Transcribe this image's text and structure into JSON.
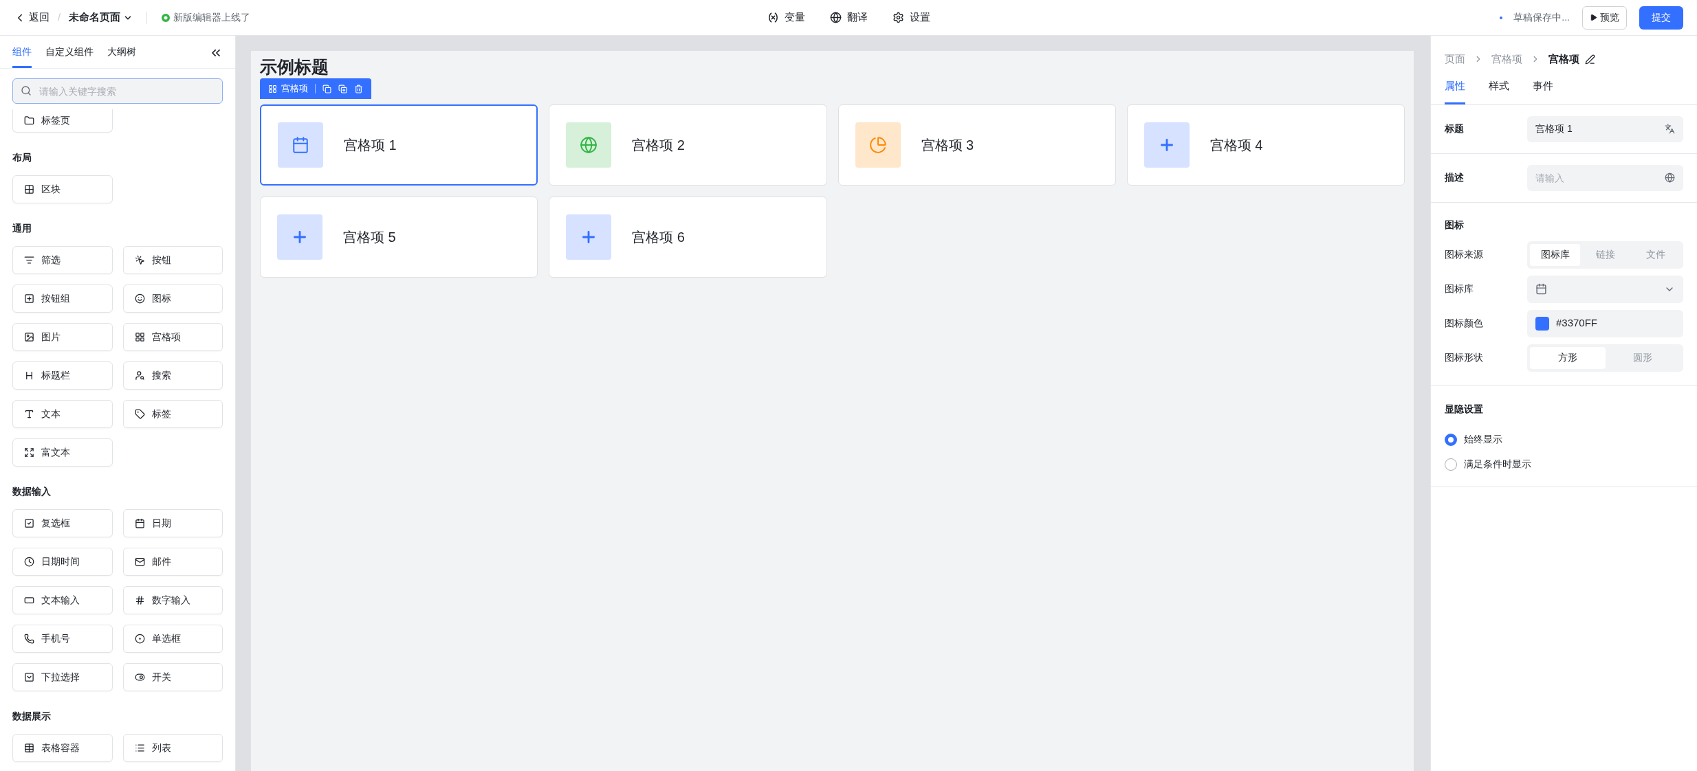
{
  "topbar": {
    "back": "返回",
    "separator": "/",
    "page_title": "未命名页面",
    "notice": "新版编辑器上线了",
    "tools": [
      "变量",
      "翻译",
      "设置"
    ],
    "save_status": "草稿保存中...",
    "preview": "预览",
    "submit": "提交"
  },
  "sidebar": {
    "tabs": [
      {
        "label": "组件",
        "selected": true
      },
      {
        "label": "自定义组件",
        "selected": false
      },
      {
        "label": "大纲树",
        "selected": false
      }
    ],
    "search": {
      "placeholder": "请输入关键字搜索"
    },
    "partial_item": "标签页",
    "sections": [
      {
        "title": "布局",
        "items": [
          "区块"
        ]
      },
      {
        "title": "通用",
        "items": [
          "筛选",
          "按钮",
          "按钮组",
          "图标",
          "图片",
          "宫格项",
          "标题栏",
          "搜索",
          "文本",
          "标签",
          "富文本"
        ]
      },
      {
        "title": "数据输入",
        "items": [
          "复选框",
          "日期",
          "日期时间",
          "邮件",
          "文本输入",
          "数字输入",
          "手机号",
          "单选框",
          "下拉选择",
          "开关"
        ]
      },
      {
        "title": "数据展示",
        "items": [
          "表格容器",
          "列表"
        ]
      }
    ]
  },
  "canvas": {
    "title": "示例标题",
    "toolbar": {
      "label": "宫格项"
    },
    "grid_items": [
      {
        "title": "宫格项 1",
        "kind": "calendar",
        "color": "#3370ff",
        "selected": true
      },
      {
        "title": "宫格项 2",
        "kind": "globe",
        "color": "#34b545",
        "selected": false
      },
      {
        "title": "宫格项 3",
        "kind": "pie",
        "color": "#ff8800",
        "selected": false
      },
      {
        "title": "宫格项 4",
        "kind": "plus",
        "color": "#3370ff",
        "selected": false
      },
      {
        "title": "宫格项 5",
        "kind": "plus",
        "color": "#3370ff",
        "selected": false
      },
      {
        "title": "宫格项 6",
        "kind": "plus",
        "color": "#3370ff",
        "selected": false
      }
    ]
  },
  "inspector": {
    "breadcrumb": [
      "页面",
      "宫格项",
      "宫格项"
    ],
    "tabs": [
      {
        "label": "属性",
        "selected": true
      },
      {
        "label": "样式",
        "selected": false
      },
      {
        "label": "事件",
        "selected": false
      }
    ],
    "title_field": {
      "label": "标题",
      "value": "宫格项 1"
    },
    "desc_field": {
      "label": "描述",
      "placeholder": "请输入"
    },
    "icon_section": {
      "title": "图标",
      "source": {
        "label": "图标来源",
        "options": [
          {
            "label": "图标库",
            "selected": true
          },
          {
            "label": "链接",
            "selected": false
          },
          {
            "label": "文件",
            "selected": false
          }
        ]
      },
      "library": {
        "label": "图标库"
      },
      "color": {
        "label": "图标颜色",
        "value": "#3370FF"
      },
      "shape": {
        "label": "图标形状",
        "options": [
          {
            "label": "方形",
            "selected": true
          },
          {
            "label": "圆形",
            "selected": false
          }
        ]
      }
    },
    "visibility": {
      "title": "显隐设置",
      "options": [
        {
          "label": "始终显示",
          "selected": true
        },
        {
          "label": "满足条件时显示",
          "selected": false
        }
      ]
    }
  }
}
